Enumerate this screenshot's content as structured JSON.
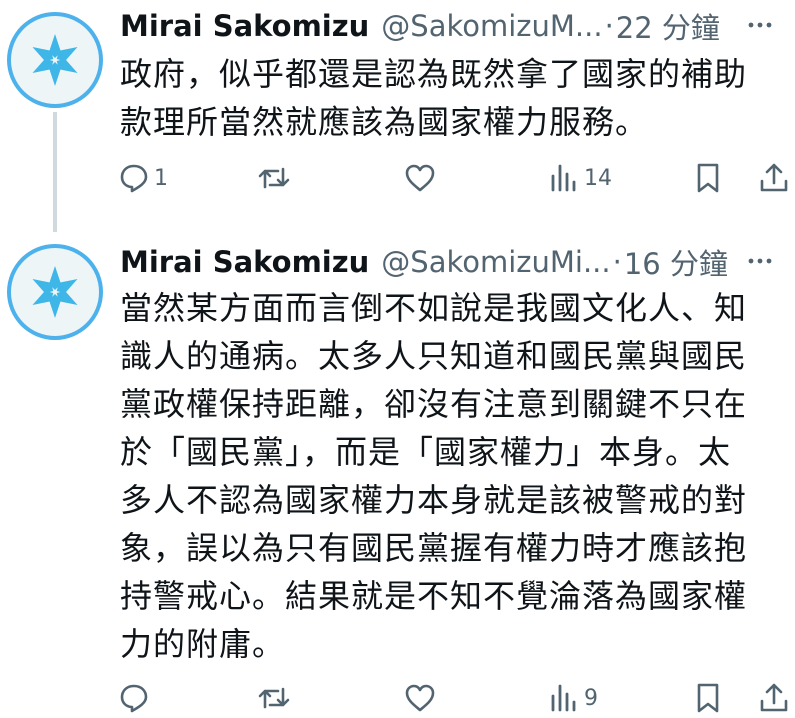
{
  "tweets": [
    {
      "author_name": "Mirai Sakomizu",
      "handle": "@SakomizuM...",
      "separator": "·",
      "time": "22 分鐘",
      "text": "政府，似乎都還是認為既然拿了國家的補助\n款理所當然就應該為國家權力服務。",
      "reply_count": "1",
      "views_count": "14"
    },
    {
      "author_name": "Mirai Sakomizu",
      "handle": "@SakomizuMi...",
      "separator": "·",
      "time": "16 分鐘",
      "text": "當然某方面而言倒不如說是我國文化人、知\n識人的通病。太多人只知道和國民黨與國民\n黨政權保持距離，卻沒有注意到關鍵不只在\n於「國民黨」，而是「國家權力」本身。太\n多人不認為國家權力本身就是該被警戒的對\n象，誤以為只有國民黨握有權力時才應該抱\n持警戒心。結果就是不知不覺淪落為國家權\n力的附庸。",
      "reply_count": "",
      "views_count": "9"
    }
  ],
  "colors": {
    "text": "#0f1419",
    "secondary": "#536471",
    "avatar_ring": "#4db2ec",
    "thread_line": "#cfd9de"
  },
  "icons": [
    "reply-icon",
    "retweet-icon",
    "like-icon",
    "views-icon",
    "bookmark-icon",
    "share-icon",
    "more-icon"
  ]
}
